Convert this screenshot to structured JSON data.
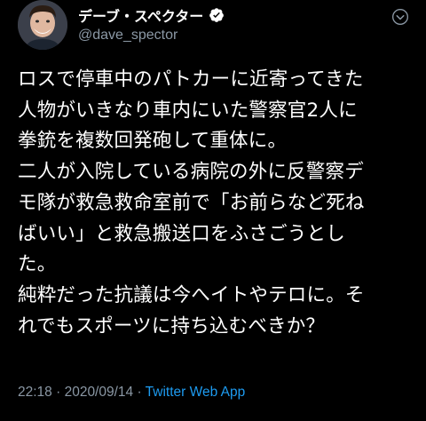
{
  "author": {
    "display_name": "デーブ・スペクター",
    "handle": "@dave_spector",
    "verified": true
  },
  "tweet": {
    "lines": [
      "ロスで停車中のパトカーに近寄ってきた",
      "人物がいきなり車内にいた警察官2人に",
      "拳銃を複数回発砲して重体に。",
      "二人が入院している病院の外に反警察デ",
      "モ隊が救急救命室前で「お前らなど死ね",
      "ばいい」と救急搬送口をふさごうとし",
      "た。",
      "純粋だった抗議は今へイトやテロに。そ",
      "れでもスポーツに持ち込むべきか？"
    ],
    "time": "22:18",
    "separator": " · ",
    "date": "2020/09/14",
    "source": "Twitter Web App"
  },
  "colors": {
    "background": "#000000",
    "text": "#ffffff",
    "secondary": "#8b98a5",
    "accent": "#1d9bf0"
  },
  "icons": {
    "verified": "verified-badge-icon",
    "more": "more-options-icon"
  }
}
